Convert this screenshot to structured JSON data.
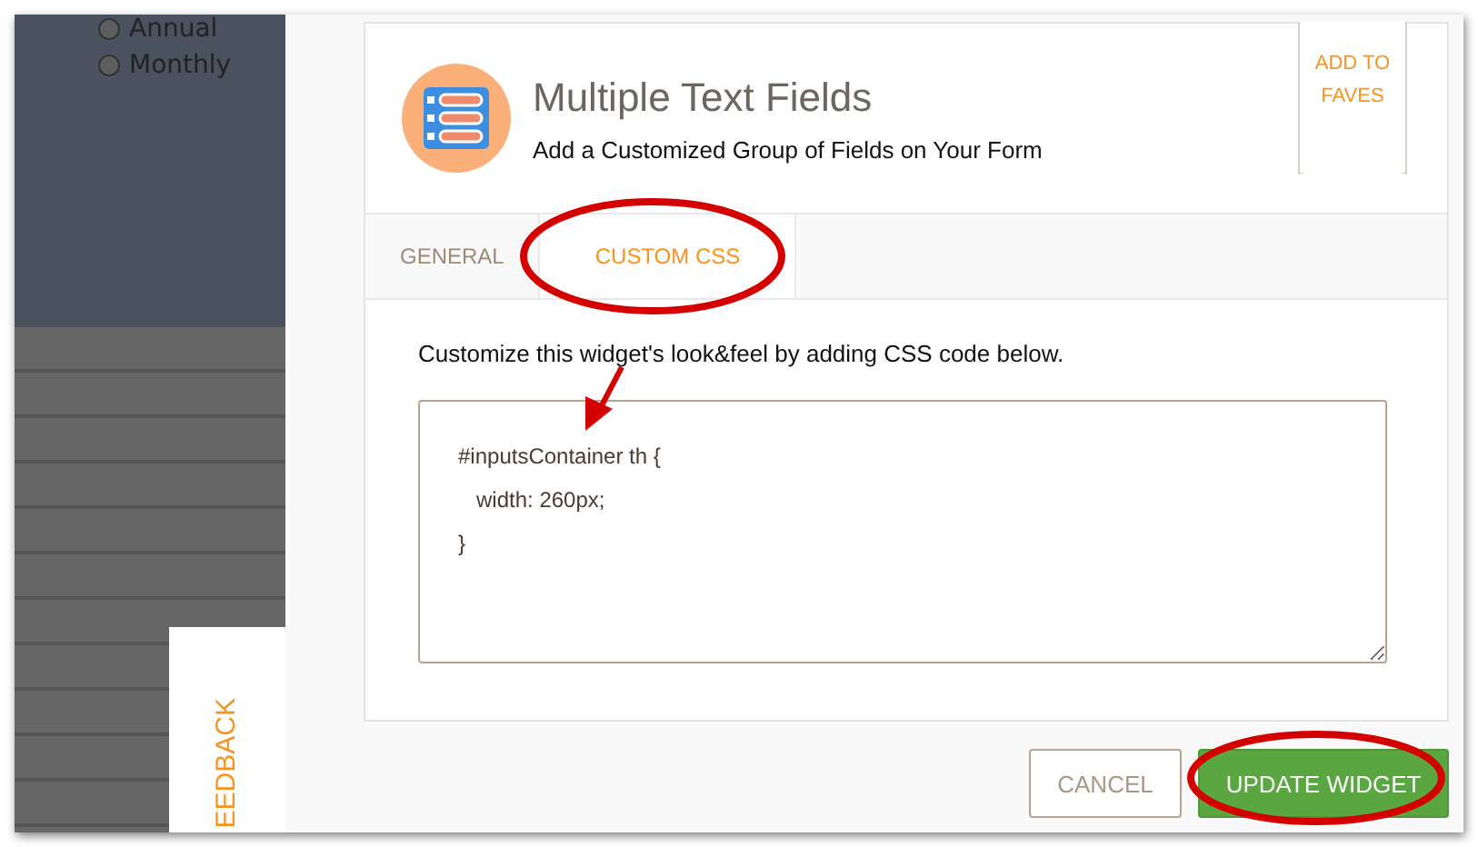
{
  "background_form": {
    "radio_options": [
      {
        "label": "Annual",
        "selected": false
      },
      {
        "label": "Monthly",
        "selected": false
      }
    ]
  },
  "feedback_tab": {
    "label": "EEDBACK"
  },
  "widget": {
    "title": "Multiple Text Fields",
    "subtitle": "Add a Customized Group of Fields on Your Form",
    "faves_button": "ADD TO FAVES"
  },
  "tabs": [
    {
      "label": "GENERAL",
      "selected": false
    },
    {
      "label": "CUSTOM CSS",
      "selected": true
    }
  ],
  "description": "Customize this widget's look&feel by adding CSS code below.",
  "css_editor": {
    "value": "#inputsContainer th {\n   width: 260px;\n}"
  },
  "buttons": [
    {
      "label": "CANCEL",
      "kind": "secondary"
    },
    {
      "label": "UPDATE WIDGET",
      "kind": "primary"
    }
  ]
}
